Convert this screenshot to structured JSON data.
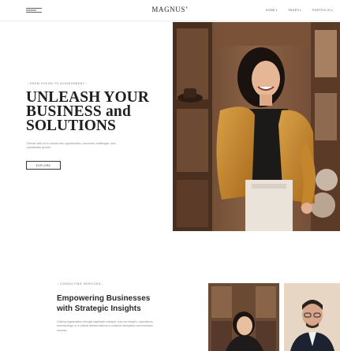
{
  "header": {
    "brand": "MAGNUS",
    "brand_mark": "®",
    "nav": [
      {
        "label": "HOME",
        "has_caret": true
      },
      {
        "label": "PAGES",
        "has_caret": true
      },
      {
        "label": "PORTFOLIO",
        "has_caret": true
      }
    ]
  },
  "hero": {
    "kicker": "FROM VISION TO ACHIEVEMENT",
    "title_line1": "UNLEASH YOUR",
    "title_line2": "BUSINESS and",
    "title_line3": "SOLUTIONS",
    "description": "Partner with us to unlock new opportunities, overcome challenges, and sustainable growth.",
    "button_label": "EXPLORE"
  },
  "services": {
    "kicker": "CONSULTING SERVICES",
    "title_line1": "Empowering Businesses",
    "title_line2": "with Strategic Insights",
    "description": "Guiding organizations through significant changes, such as mergers, acquisitions, restructurings, or a cultural transformations to minimize disruptions and maximize success."
  },
  "colors": {
    "accent_jacket": "#c98a2c",
    "wood": "#9a6b45",
    "text_dark": "#1f1f1f",
    "text_muted": "#8a8a8a"
  }
}
